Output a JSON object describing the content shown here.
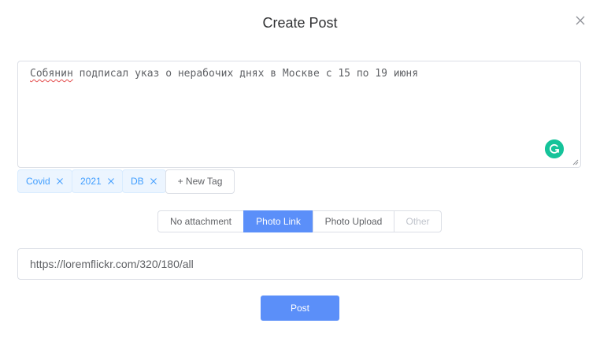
{
  "dialog": {
    "title": "Create Post"
  },
  "post_text": {
    "word1": "Собянин",
    "rest": " подписал указ о нерабочих днях в Москве с 15 по 19 июня"
  },
  "tags": [
    "Covid",
    "2021",
    "DB"
  ],
  "new_tag_label": "+ New Tag",
  "attachment_options": [
    {
      "label": "No attachment",
      "state": "normal"
    },
    {
      "label": "Photo Link",
      "state": "active"
    },
    {
      "label": "Photo Upload",
      "state": "normal"
    },
    {
      "label": "Other",
      "state": "disabled"
    }
  ],
  "photo_link": {
    "value": "https://loremflickr.com/320/180/all"
  },
  "post_button": {
    "label": "Post"
  },
  "colors": {
    "primary": "#5b8ff9",
    "tag_text": "#409eff",
    "grammarly": "#15c39a"
  },
  "icons": [
    "close-icon",
    "grammarly-icon",
    "tag-close-icon",
    "resize-handle-icon"
  ]
}
